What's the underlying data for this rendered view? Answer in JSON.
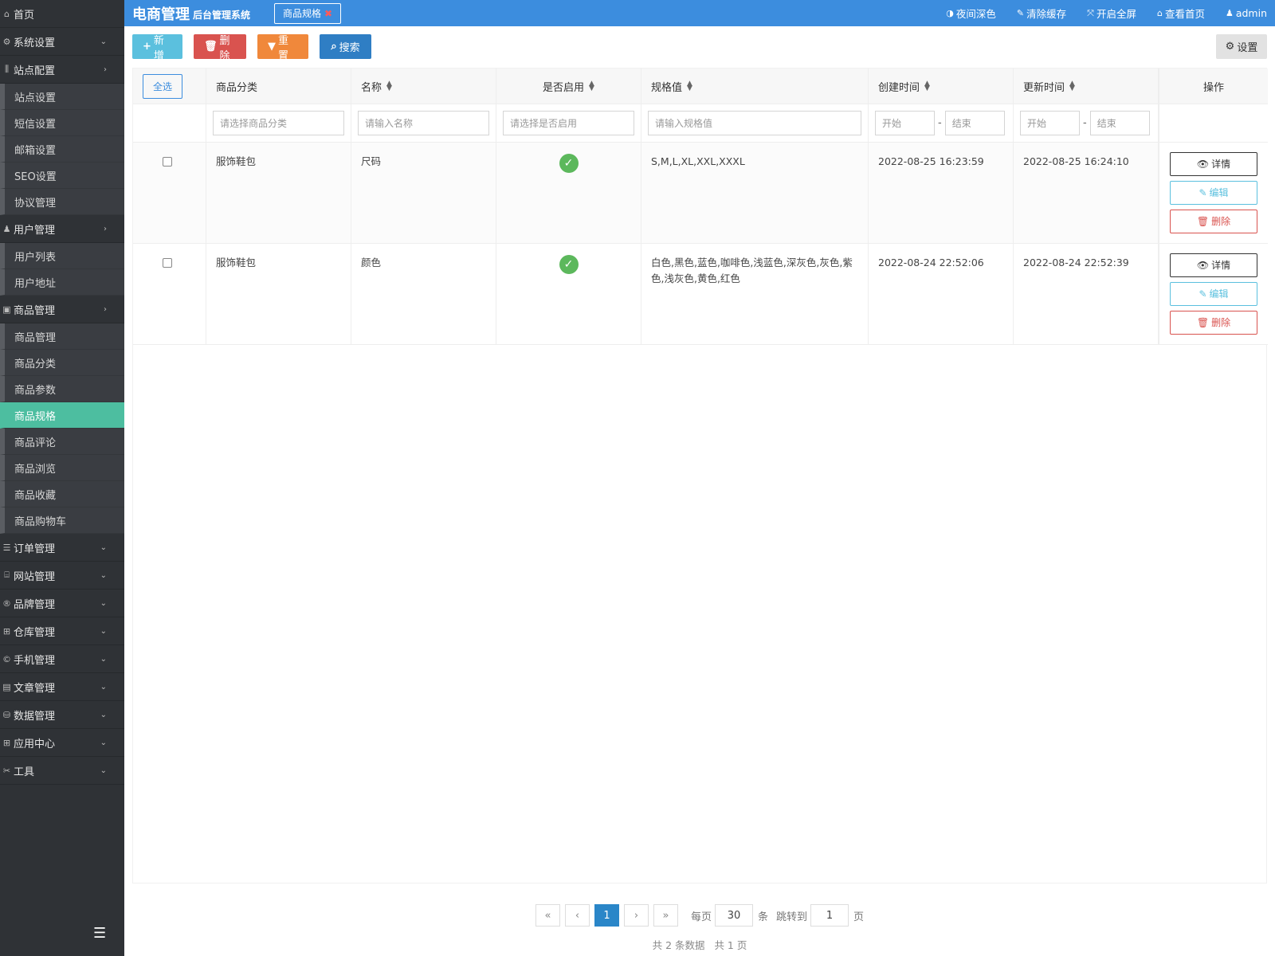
{
  "sidebar": {
    "home": "首页",
    "menus": [
      {
        "label": "系统设置",
        "icon": "gear-icon",
        "glyph": "⚙",
        "arrow": "⌄"
      },
      {
        "label": "站点配置",
        "icon": "sliders-icon",
        "glyph": "⫼",
        "arrow": "›"
      },
      {
        "label": "用户管理",
        "icon": "user-icon",
        "glyph": "♟",
        "arrow": "›"
      },
      {
        "label": "商品管理",
        "icon": "shop-icon",
        "glyph": "▣",
        "arrow": "›"
      },
      {
        "label": "订单管理",
        "icon": "list-icon",
        "glyph": "☰",
        "arrow": "⌄"
      },
      {
        "label": "网站管理",
        "icon": "web-icon",
        "glyph": "⌸",
        "arrow": "⌄"
      },
      {
        "label": "品牌管理",
        "icon": "brand-icon",
        "glyph": "®",
        "arrow": "⌄"
      },
      {
        "label": "仓库管理",
        "icon": "warehouse-icon",
        "glyph": "⊞",
        "arrow": "⌄"
      },
      {
        "label": "手机管理",
        "icon": "phone-icon",
        "glyph": "©",
        "arrow": "⌄"
      },
      {
        "label": "文章管理",
        "icon": "article-icon",
        "glyph": "▤",
        "arrow": "⌄"
      },
      {
        "label": "数据管理",
        "icon": "database-icon",
        "glyph": "⛁",
        "arrow": "⌄"
      },
      {
        "label": "应用中心",
        "icon": "apps-icon",
        "glyph": "⊞",
        "arrow": "⌄"
      },
      {
        "label": "工具",
        "icon": "tools-icon",
        "glyph": "✂",
        "arrow": "⌄"
      }
    ],
    "site_subs": [
      "站点设置",
      "短信设置",
      "邮箱设置",
      "SEO设置",
      "协议管理"
    ],
    "user_subs": [
      "用户列表",
      "用户地址"
    ],
    "goods_subs": [
      "商品管理",
      "商品分类",
      "商品参数",
      "商品规格",
      "商品评论",
      "商品浏览",
      "商品收藏",
      "商品购物车"
    ],
    "active": "商品规格"
  },
  "topbar": {
    "brand": "电商管理",
    "brand_sub": "后台管理系统",
    "tab": "商品规格",
    "nav": [
      "夜间深色",
      "清除缓存",
      "开启全屏",
      "查看首页",
      "admin"
    ]
  },
  "toolbar": {
    "add": "新增",
    "delete": "删除",
    "reset": "重置",
    "search": "搜索",
    "settings": "设置"
  },
  "table": {
    "select_all": "全选",
    "columns": [
      "商品分类",
      "名称",
      "是否启用",
      "规格值",
      "创建时间",
      "更新时间",
      "操作"
    ],
    "filters": {
      "category": "请选择商品分类",
      "name": "请输入名称",
      "enabled": "请选择是否启用",
      "value": "请输入规格值",
      "start": "开始",
      "end": "结束",
      "dash": "-"
    },
    "rows": [
      {
        "category": "服饰鞋包",
        "name": "尺码",
        "enabled": true,
        "value": "S,M,L,XL,XXL,XXXL",
        "created": "2022-08-25 16:23:59",
        "updated": "2022-08-25 16:24:10"
      },
      {
        "category": "服饰鞋包",
        "name": "颜色",
        "enabled": true,
        "value": "白色,黑色,蓝色,咖啡色,浅蓝色,深灰色,灰色,紫色,浅灰色,黄色,红色",
        "created": "2022-08-24 22:52:06",
        "updated": "2022-08-24 22:52:39"
      }
    ],
    "ops": {
      "detail": "详情",
      "edit": "编辑",
      "delete": "删除"
    }
  },
  "pager": {
    "first": "«",
    "prev": "‹",
    "current": "1",
    "next": "›",
    "last": "»",
    "per_page_label": "每页",
    "per_page": "30",
    "unit": "条",
    "jump_label": "跳转到",
    "jump_value": "1",
    "page_unit": "页",
    "summary": "共 2 条数据   共 1 页"
  },
  "colors": {
    "topbar": "#3c8dde",
    "sidebar": "#2f3236",
    "active": "#4dbea0"
  }
}
